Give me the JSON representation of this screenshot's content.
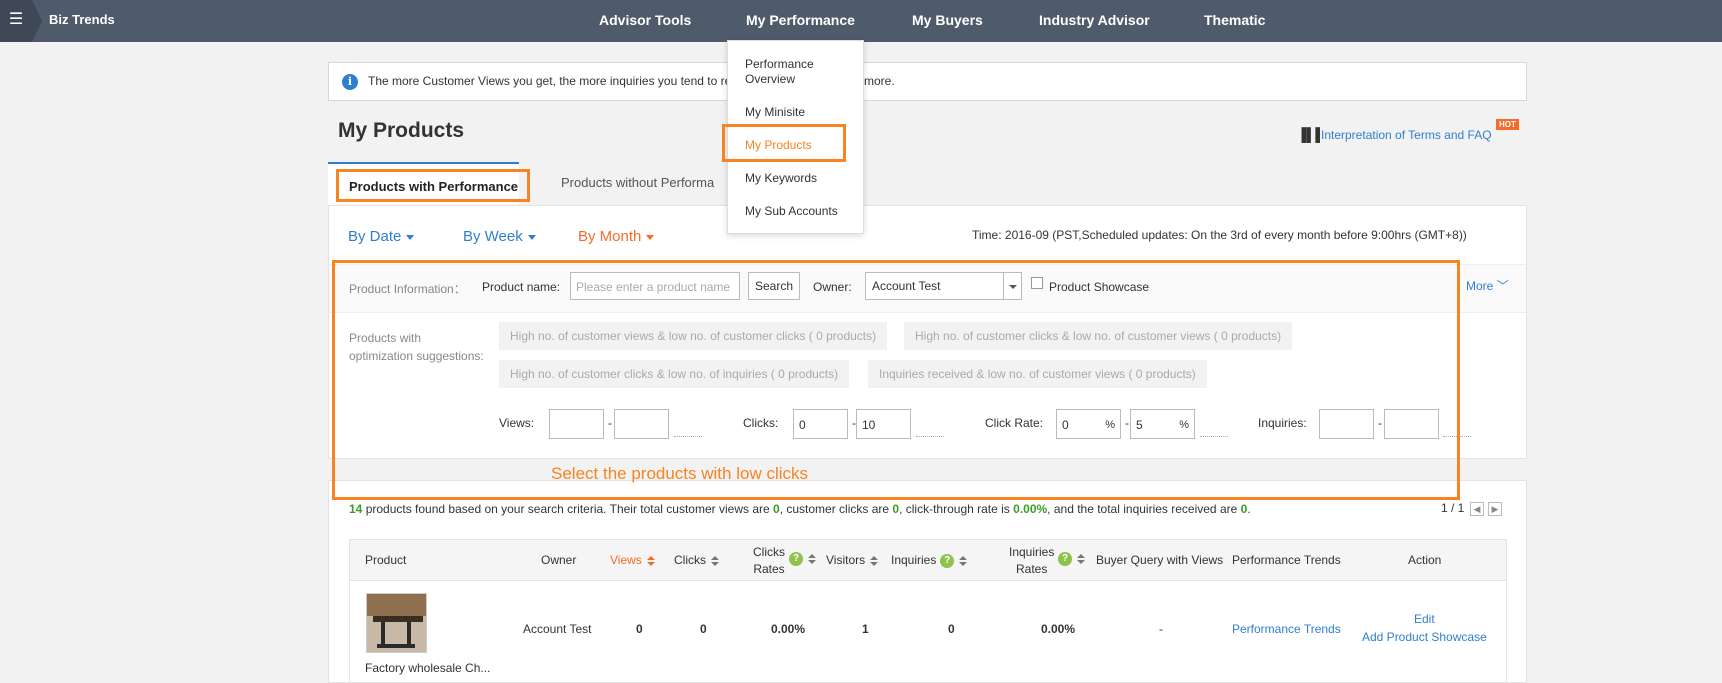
{
  "topbar": {
    "brand": "Biz Trends",
    "nav": [
      "Advisor Tools",
      "My Performance",
      "My Buyers",
      "Industry Advisor",
      "Thematic"
    ]
  },
  "dropdown": {
    "items": [
      "Performance Overview",
      "My Minisite",
      "My Products",
      "My Keywords",
      "My Sub Accounts"
    ],
    "active_index": 2
  },
  "info": {
    "icon": "info-icon",
    "text_left": "The more Customer Views you get, the more inquiries you tend to re",
    "text_right": "more."
  },
  "page": {
    "title": "My Products",
    "faq_link": "Interpretation of Terms and FAQ",
    "hot_badge": "HOT"
  },
  "tabs": {
    "active": "Products with Performance",
    "inactive": "Products without Performa"
  },
  "period": {
    "by_date": "By Date",
    "by_week": "By Week",
    "by_month": "By Month",
    "selected": "By Month",
    "time": "Time: 2016-09 (PST,Scheduled updates: On the 3rd of every month before 9:00hrs (GMT+8))"
  },
  "filters": {
    "product_info_label": "Product Information：",
    "product_name_label": "Product name:",
    "product_name_placeholder": "Please enter a product name",
    "search_button": "Search",
    "owner_label": "Owner:",
    "owner_value": "Account Test",
    "showcase_label": "Product Showcase",
    "showcase_checked": false,
    "more": "More",
    "suggestions_label_1": "Products with",
    "suggestions_label_2": "optimization suggestions:",
    "suggestions": [
      "High no. of customer views & low no. of customer clicks ( 0 products)",
      "High no. of customer clicks & low no. of customer views ( 0 products)",
      "High no. of customer clicks & low no. of inquiries ( 0 products)",
      "Inquiries received & low no. of customer views ( 0 products)"
    ],
    "views_label": "Views:",
    "views_min": "",
    "views_max": "",
    "clicks_label": "Clicks:",
    "clicks_min": "0",
    "clicks_max": "10",
    "click_rate_label": "Click Rate:",
    "click_rate_min": "0",
    "click_rate_max": "5",
    "percent": "%",
    "inquiries_label": "Inquiries:",
    "inquiries_min": "",
    "inquiries_max": "",
    "dash": "-"
  },
  "annotation": {
    "text": "Select the products with low clicks",
    "color": "#f68421"
  },
  "results": {
    "count": "14",
    "text1": " products found based on your search criteria. Their total customer views are ",
    "views": "0",
    "text2": ", customer clicks are ",
    "clicks": "0",
    "text3": ", click-through rate is ",
    "ctr": "0.00%",
    "text4": ", and the total inquiries received are ",
    "inquiries": "0",
    "text5": ".",
    "pager": "1 / 1"
  },
  "table": {
    "headers": {
      "product": "Product",
      "owner": "Owner",
      "views": "Views",
      "clicks": "Clicks",
      "clicks_rates_1": "Clicks",
      "clicks_rates_2": "Rates",
      "visitors": "Visitors",
      "inquiries": "Inquiries",
      "inq_rates_1": "Inquiries",
      "inq_rates_2": "Rates",
      "buyer_query": "Buyer Query with Views",
      "trends": "Performance Trends",
      "action": "Action"
    },
    "rows": [
      {
        "product": "Factory wholesale Ch...",
        "owner": "Account Test",
        "views": "0",
        "clicks": "0",
        "clicks_rate": "0.00%",
        "visitors": "1",
        "inquiries": "0",
        "inquiries_rate": "0.00%",
        "buyer_query": "-",
        "trends": "Performance Trends",
        "edit": "Edit",
        "add_showcase": "Add Product Showcase"
      }
    ]
  },
  "colors": {
    "topbar": "#4f5a6a",
    "accent_orange": "#f68421",
    "link_blue": "#2f7fd0",
    "green": "#3a9d23"
  }
}
